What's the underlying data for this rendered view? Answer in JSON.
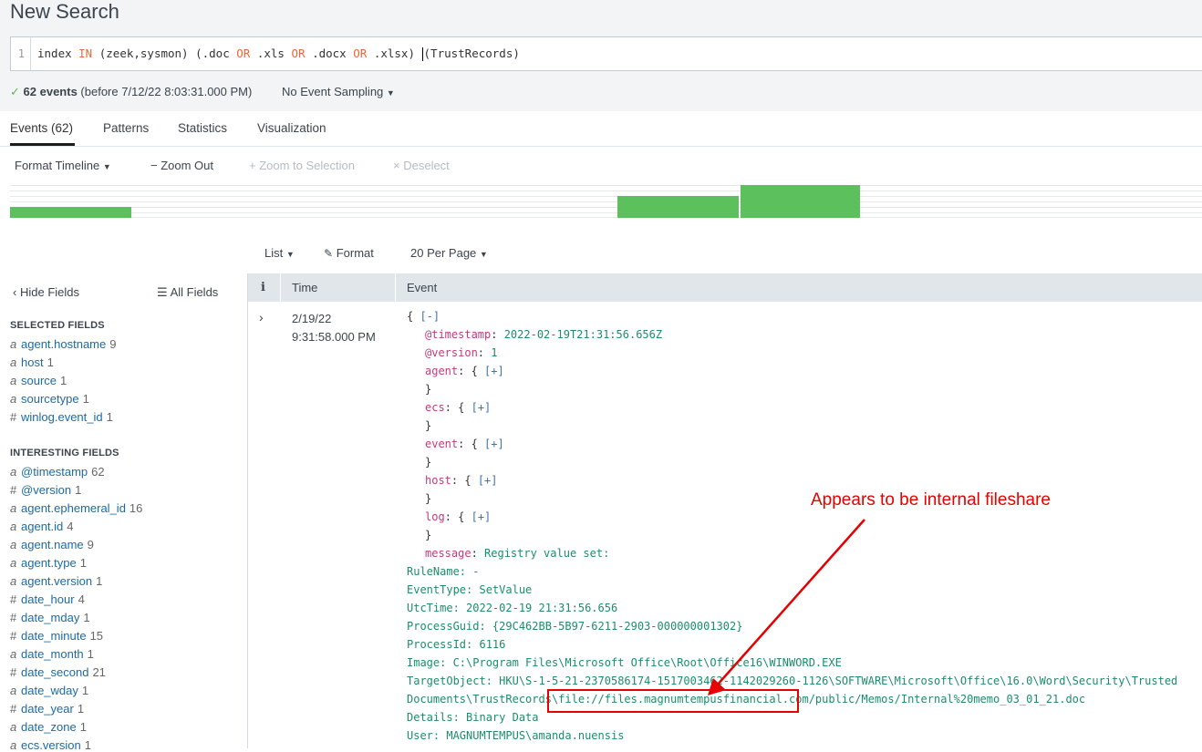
{
  "page": {
    "title": "New Search"
  },
  "search": {
    "line_number": "1",
    "query_parts": [
      "index ",
      "IN",
      " (zeek,sysmon) (.doc ",
      "OR",
      " .xls ",
      "OR",
      " .docx ",
      "OR",
      " .xlsx) ",
      "(TrustRecords)"
    ]
  },
  "status": {
    "count": "62 events",
    "range": "(before 7/12/22 8:03:31.000 PM)",
    "sampling": "No Event Sampling"
  },
  "tabs": [
    "Events (62)",
    "Patterns",
    "Statistics",
    "Visualization"
  ],
  "timeline_toolbar": {
    "format": "Format Timeline",
    "zoom_out": "Zoom Out",
    "zoom_sel": "Zoom to Selection",
    "deselect": "Deselect"
  },
  "timeline_bars": [
    {
      "start": 0.0,
      "end": 0.1015,
      "value": 1
    },
    {
      "start": 0.5095,
      "end": 0.611,
      "value": 2
    },
    {
      "start": 0.6125,
      "end": 0.713,
      "value": 3
    }
  ],
  "list_toolbar": {
    "list": "List",
    "format": "Format",
    "per_page": "20 Per Page"
  },
  "fields": {
    "hide": "Hide Fields",
    "all": "All Fields",
    "selected_title": "SELECTED FIELDS",
    "selected": [
      {
        "t": "a",
        "n": "agent.hostname",
        "c": "9"
      },
      {
        "t": "a",
        "n": "host",
        "c": "1"
      },
      {
        "t": "a",
        "n": "source",
        "c": "1"
      },
      {
        "t": "a",
        "n": "sourcetype",
        "c": "1"
      },
      {
        "t": "#",
        "n": "winlog.event_id",
        "c": "1"
      }
    ],
    "interesting_title": "INTERESTING FIELDS",
    "interesting": [
      {
        "t": "a",
        "n": "@timestamp",
        "c": "62"
      },
      {
        "t": "#",
        "n": "@version",
        "c": "1"
      },
      {
        "t": "a",
        "n": "agent.ephemeral_id",
        "c": "16"
      },
      {
        "t": "a",
        "n": "agent.id",
        "c": "4"
      },
      {
        "t": "a",
        "n": "agent.name",
        "c": "9"
      },
      {
        "t": "a",
        "n": "agent.type",
        "c": "1"
      },
      {
        "t": "a",
        "n": "agent.version",
        "c": "1"
      },
      {
        "t": "#",
        "n": "date_hour",
        "c": "4"
      },
      {
        "t": "#",
        "n": "date_mday",
        "c": "1"
      },
      {
        "t": "#",
        "n": "date_minute",
        "c": "15"
      },
      {
        "t": "a",
        "n": "date_month",
        "c": "1"
      },
      {
        "t": "#",
        "n": "date_second",
        "c": "21"
      },
      {
        "t": "a",
        "n": "date_wday",
        "c": "1"
      },
      {
        "t": "#",
        "n": "date_year",
        "c": "1"
      },
      {
        "t": "a",
        "n": "date_zone",
        "c": "1"
      },
      {
        "t": "a",
        "n": "ecs.version",
        "c": "1"
      }
    ]
  },
  "table": {
    "info": "i",
    "time": "Time",
    "event": "Event"
  },
  "event": {
    "date": "2/19/22",
    "time": "9:31:58.000 PM",
    "lines": [
      {
        "parts": [
          [
            "brk",
            "{ "
          ],
          [
            "lnk",
            "[-]"
          ]
        ]
      },
      {
        "parts": [
          [
            "key",
            "@timestamp"
          ],
          [
            "brk",
            ": "
          ],
          [
            "val",
            "2022-02-19T21:31:56.656Z"
          ]
        ],
        "indent": true
      },
      {
        "parts": [
          [
            "key",
            "@version"
          ],
          [
            "brk",
            ": "
          ],
          [
            "val",
            "1"
          ]
        ],
        "indent": true
      },
      {
        "parts": [
          [
            "key",
            "agent"
          ],
          [
            "brk",
            ": { "
          ],
          [
            "lnk",
            "[+]"
          ]
        ],
        "indent": true
      },
      {
        "parts": [
          [
            "brk",
            "}"
          ]
        ],
        "indent": true
      },
      {
        "parts": [
          [
            "key",
            "ecs"
          ],
          [
            "brk",
            ": { "
          ],
          [
            "lnk",
            "[+]"
          ]
        ],
        "indent": true
      },
      {
        "parts": [
          [
            "brk",
            "}"
          ]
        ],
        "indent": true
      },
      {
        "parts": [
          [
            "key",
            "event"
          ],
          [
            "brk",
            ": { "
          ],
          [
            "lnk",
            "[+]"
          ]
        ],
        "indent": true
      },
      {
        "parts": [
          [
            "brk",
            "}"
          ]
        ],
        "indent": true
      },
      {
        "parts": [
          [
            "key",
            "host"
          ],
          [
            "brk",
            ": { "
          ],
          [
            "lnk",
            "[+]"
          ]
        ],
        "indent": true
      },
      {
        "parts": [
          [
            "brk",
            "}"
          ]
        ],
        "indent": true
      },
      {
        "parts": [
          [
            "key",
            "log"
          ],
          [
            "brk",
            ": { "
          ],
          [
            "lnk",
            "[+]"
          ]
        ],
        "indent": true
      },
      {
        "parts": [
          [
            "brk",
            "}"
          ]
        ],
        "indent": true
      },
      {
        "parts": [
          [
            "key",
            "message"
          ],
          [
            "brk",
            ": "
          ],
          [
            "val",
            "Registry value set:"
          ]
        ],
        "indent": true
      },
      {
        "parts": [
          [
            "val",
            "RuleName: -"
          ]
        ]
      },
      {
        "parts": [
          [
            "val",
            "EventType: SetValue"
          ]
        ]
      },
      {
        "parts": [
          [
            "val",
            "UtcTime: 2022-02-19 21:31:56.656"
          ]
        ]
      },
      {
        "parts": [
          [
            "val",
            "ProcessGuid: {29C462BB-5B97-6211-2903-000000001302}"
          ]
        ]
      },
      {
        "parts": [
          [
            "val",
            "ProcessId: 6116"
          ]
        ]
      },
      {
        "parts": [
          [
            "val",
            "Image: C:\\Program Files\\Microsoft Office\\Root\\Office16\\WINWORD.EXE"
          ]
        ]
      },
      {
        "parts": [
          [
            "val",
            "TargetObject: HKU\\S-1-5-21-2370586174-1517003462-1142029260-1126\\SOFTWARE\\Microsoft\\Office\\16.0\\Word\\Security\\Trusted"
          ]
        ]
      },
      {
        "parts": [
          [
            "val",
            "Documents\\TrustRecords\\file://files.magnumtempusfinancial.com/public/Memos/Internal%20memo_03_01_21.doc"
          ]
        ]
      },
      {
        "parts": [
          [
            "val",
            "Details: Binary Data"
          ]
        ]
      },
      {
        "parts": [
          [
            "val",
            "User: MAGNUMTEMPUS\\amanda.nuensis"
          ]
        ]
      }
    ]
  },
  "annotation": {
    "text": "Appears to be internal fileshare",
    "color": "#e60000"
  },
  "colors": {
    "accent_green": "#5cc05c",
    "key": "#c23b7b",
    "value": "#1e8c6a",
    "link": "#3d72b4"
  }
}
